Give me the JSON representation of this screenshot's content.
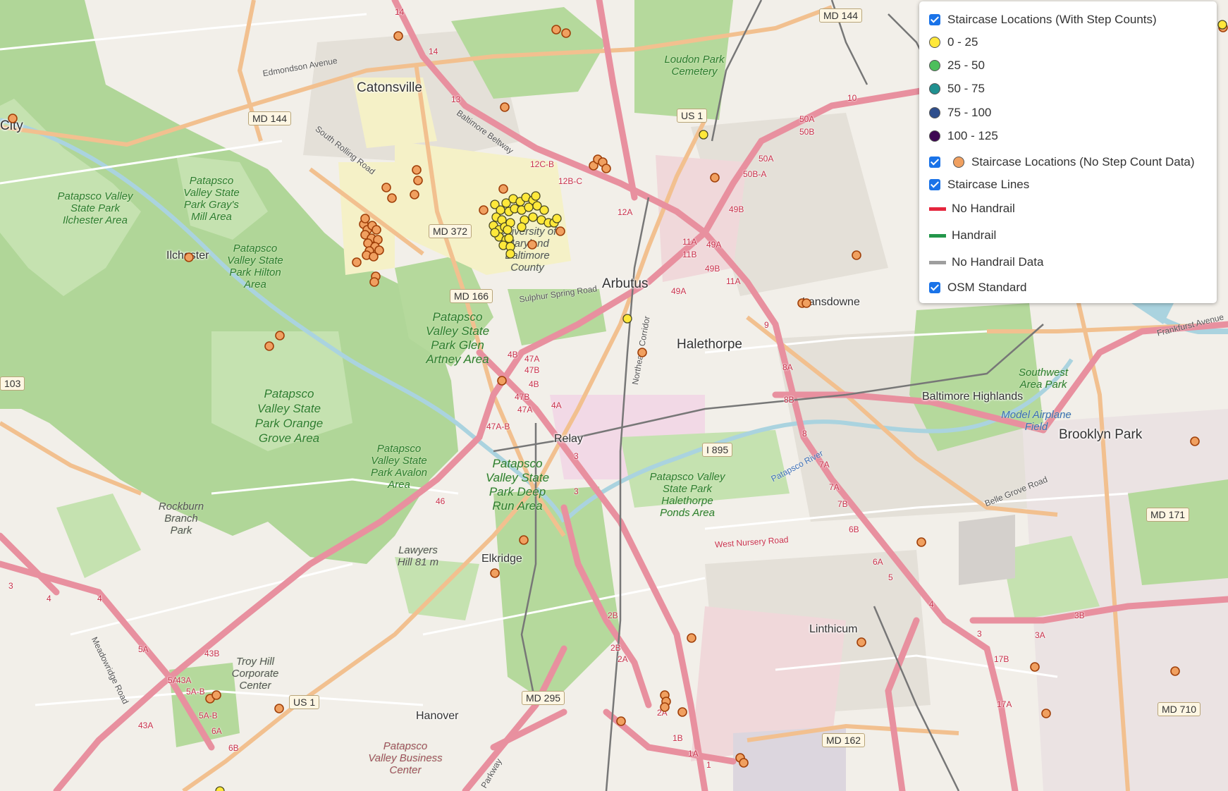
{
  "colors": {
    "land": "#f2efe9",
    "park": "#b5d99c",
    "forest": "#9dcb85",
    "motorway": "#e8909f",
    "trunk": "#f6c99a",
    "residential": "#e0dcd5",
    "step_0_25": "#ffe83a",
    "step_25_50": "#4dbf5c",
    "step_50_75": "#1f9090",
    "step_75_100": "#2e4e8c",
    "step_100_125": "#3d0752",
    "no_step": "#f0a060"
  },
  "legend": {
    "with_counts": {
      "label": "Staircase Locations (With Step Counts)"
    },
    "ranges": [
      {
        "label": "0 - 25",
        "color": "#ffe83a"
      },
      {
        "label": "25 - 50",
        "color": "#4dbf5c"
      },
      {
        "label": "50 - 75",
        "color": "#1f9090"
      },
      {
        "label": "75 - 100",
        "color": "#2e4e8c"
      },
      {
        "label": "100 - 125",
        "color": "#3d0752"
      }
    ],
    "no_counts": {
      "label": "Staircase Locations (No Step Count Data)"
    },
    "lines": {
      "label": "Staircase Lines"
    },
    "line_types": [
      {
        "label": "No Handrail",
        "color": "#e5253d"
      },
      {
        "label": "Handrail",
        "color": "#23964a"
      },
      {
        "label": "No Handrail Data",
        "color": "#9e9e9e"
      }
    ],
    "osm": {
      "label": "OSM Standard"
    }
  },
  "places": [
    "Catonsville",
    "Arbutus",
    "Halethorpe",
    "Relay",
    "Elkridge",
    "Lansdowne",
    "Baltimore Highlands",
    "Brooklyn Park",
    "Linthicum",
    "Hanover",
    "Ilchester",
    "City"
  ],
  "parks": [
    "Loudon Park Cemetery",
    "Patapsco Valley State Park Ilchester Area",
    "Patapsco Valley State Park Gray's Mill Area",
    "Patapsco Valley State Park Hilton Area",
    "Patapsco Valley State Park Glen Artney Area",
    "Patapsco Valley State Park Orange Grove Area",
    "Patapsco Valley State Park Avalon Area",
    "Patapsco Valley State Park Deep Run Area",
    "Patapsco Valley State Park Halethorpe Ponds Area",
    "Rockburn Branch Park",
    "Lawyers Hill 81 m",
    "Troy Hill Corporate Center",
    "Patapsco Valley Business Center",
    "Southwest Area Park",
    "Model Airplane Field",
    "University of Maryland Baltimore County"
  ],
  "roads": [
    "Edmondson Avenue",
    "South Rolling Road",
    "Baltimore Beltway",
    "Sulphur Spring Road",
    "Northeast Corridor",
    "West Nursery Road",
    "Patapsco River",
    "Meadowridge Road",
    "Belle Grove Road",
    "Parkway",
    "Frankfurst Avenue"
  ],
  "shields": [
    "MD 144",
    "MD 144",
    "US 1",
    "MD 372",
    "MD 166",
    "I 895",
    "MD 171",
    "MD 295",
    "US 1",
    "MD 162",
    "MD 710",
    "103"
  ],
  "exits": [
    "14",
    "14",
    "13",
    "12C-B",
    "12B-C",
    "12A",
    "11A",
    "11B",
    "49A",
    "49B",
    "49B",
    "11A",
    "49A",
    "50A",
    "50A",
    "50B",
    "50B-A",
    "10",
    "9",
    "8A",
    "8B",
    "8",
    "7A",
    "7A",
    "7B",
    "6B",
    "6A",
    "5",
    "4",
    "3",
    "3A",
    "3B",
    "17B",
    "17A",
    "4B",
    "47A",
    "47B",
    "4B",
    "4A",
    "47B",
    "47A",
    "47A-B",
    "3",
    "3",
    "46",
    "4",
    "4",
    "5A",
    "5A",
    "43A",
    "43B",
    "5A-B",
    "5A-B",
    "6A",
    "6B",
    "43A",
    "3",
    "2B",
    "2B",
    "2A",
    "2A",
    "1B",
    "1A",
    "1"
  ]
}
